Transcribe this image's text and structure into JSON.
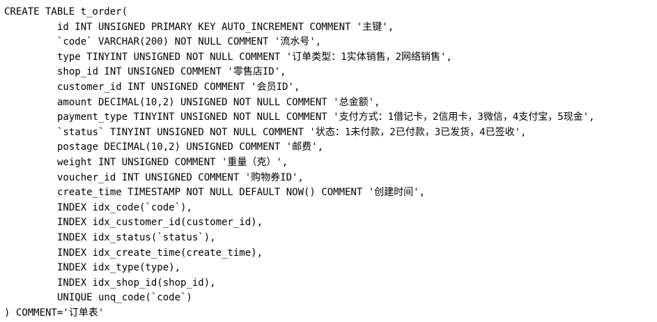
{
  "code": {
    "lines": [
      "CREATE TABLE t_order(",
      "id INT UNSIGNED PRIMARY KEY AUTO_INCREMENT COMMENT '主键',",
      "`code` VARCHAR(200) NOT NULL COMMENT '流水号',",
      "type TINYINT UNSIGNED NOT NULL COMMENT '订单类型：1实体销售，2网络销售',",
      "shop_id INT UNSIGNED COMMENT '零售店ID',",
      "customer_id INT UNSIGNED COMMENT '会员ID',",
      "amount DECIMAL(10,2) UNSIGNED NOT NULL COMMENT '总金额',",
      "payment_type TINYINT UNSIGNED NOT NULL COMMENT '支付方式：1借记卡，2信用卡，3微信，4支付宝，5现金',",
      "`status` TINYINT UNSIGNED NOT NULL COMMENT '状态：1未付款，2已付款，3已发货，4已签收',",
      "postage DECIMAL(10,2) UNSIGNED COMMENT '邮费',",
      "weight INT UNSIGNED COMMENT '重量（克）',",
      "voucher_id INT UNSIGNED COMMENT '购物券ID',",
      "create_time TIMESTAMP NOT NULL DEFAULT NOW() COMMENT '创建时间',",
      "INDEX idx_code(`code`),",
      "INDEX idx_customer_id(customer_id),",
      "INDEX idx_status(`status`),",
      "INDEX idx_create_time(create_time),",
      "INDEX idx_type(type),",
      "INDEX idx_shop_id(shop_id),",
      "UNIQUE unq_code(`code`)",
      ") COMMENT='订单表'"
    ]
  }
}
